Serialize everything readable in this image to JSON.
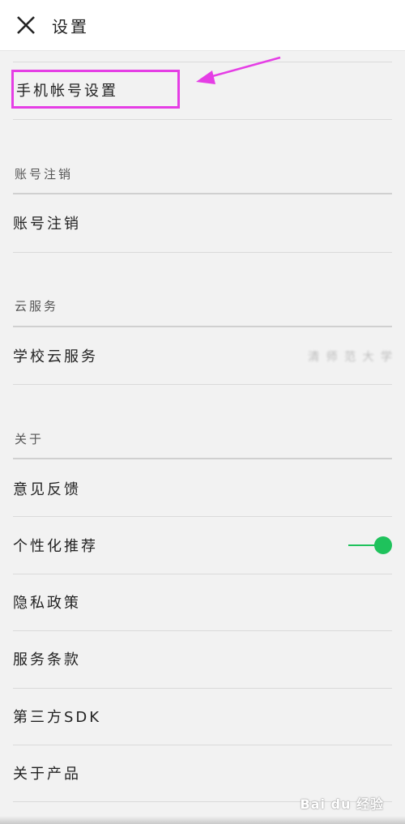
{
  "header": {
    "title": "设置"
  },
  "account": {
    "phone_label": "手机帐号设置"
  },
  "cancel_section": {
    "header": "账号注销",
    "item_label": "账号注销"
  },
  "cloud_section": {
    "header": "云服务",
    "item_label": "学校云服务",
    "item_value": "清 师 范 大 学"
  },
  "about_section": {
    "header": "关于",
    "items": [
      "意见反馈",
      "个性化推荐",
      "隐私政策",
      "服务条款",
      "第三方SDK",
      "关于产品"
    ],
    "personalization_enabled": true
  },
  "watermark": "Bai du 经验",
  "colors": {
    "accent_toggle": "#1fc25c",
    "highlight": "#e53ee5",
    "background": "#f2f2f2"
  }
}
